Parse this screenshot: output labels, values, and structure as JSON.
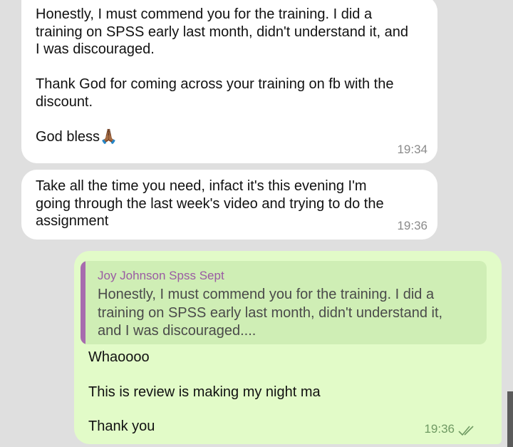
{
  "messages": [
    {
      "text": "Honestly, I must commend you for the training. I did a\ntraining on SPSS early last month, didn't understand it, and\nI was discouraged.\n\nThank God for coming across your training on fb with the\ndiscount.\n\nGod bless🙏🏾",
      "time": "19:34"
    },
    {
      "text": "Take all the time you need, infact it's this evening I'm\ngoing through the last week's video and trying to do the\nassignment",
      "time": "19:36"
    }
  ],
  "outgoing": {
    "reply": {
      "name": "Joy Johnson Spss Sept",
      "text": "Honestly, I must commend you for the training. I did a\ntraining on SPSS early last month, didn't understand it,\nand I was discouraged...."
    },
    "text": "Whaoooo\n\nThis is review is making my night ma\n\nThank you",
    "time": "19:36",
    "status_icon": "double-check-icon"
  },
  "colors": {
    "background": "#dfdfdf",
    "incoming_bubble": "#ffffff",
    "outgoing_bubble": "#e2fbc8",
    "reply_accent": "#a76cae"
  }
}
